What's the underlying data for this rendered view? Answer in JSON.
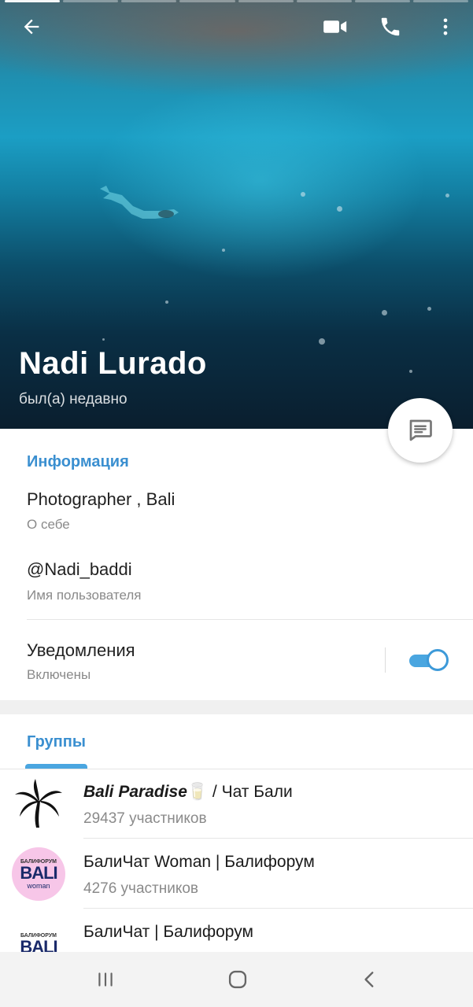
{
  "profile": {
    "name": "Nadi Lurado",
    "status": "был(а) недавно"
  },
  "header_icons": {
    "back": "arrow-left-icon",
    "video": "video-camera-icon",
    "call": "phone-icon",
    "more": "more-vertical-icon"
  },
  "story_bars": {
    "count": 8,
    "active_index": 0
  },
  "info": {
    "section_title": "Информация",
    "bio": {
      "value": "Photographer , Bali",
      "label": "О себе"
    },
    "username": {
      "value": "@Nadi_baddi",
      "label": "Имя пользователя"
    },
    "notifications": {
      "title": "Уведомления",
      "status": "Включены",
      "enabled": true
    }
  },
  "groups": {
    "tab_label": "Группы",
    "items": [
      {
        "name_emphasis": "Bali Paradise",
        "emoji": "🥛",
        "name_rest": " / Чат Бали",
        "members": "29437 участников",
        "avatar": "palm-tree"
      },
      {
        "name_emphasis": "",
        "emoji": "",
        "name_rest": "БалиЧат Woman | Балифорум",
        "members": "4276 участников",
        "avatar": "bali-woman-logo"
      },
      {
        "name_emphasis": "",
        "emoji": "",
        "name_rest": "БалиЧат | Балифорум",
        "members": "",
        "avatar": "bali-logo"
      }
    ],
    "logo_text": {
      "top": "БАЛИФОРУМ",
      "main": "BALI",
      "sub": "woman"
    }
  },
  "colors": {
    "accent": "#3a8fd0",
    "toggle": "#4aa6e0"
  },
  "navbar": {
    "recents": "recents-icon",
    "home": "home-icon",
    "back": "nav-back-icon"
  }
}
